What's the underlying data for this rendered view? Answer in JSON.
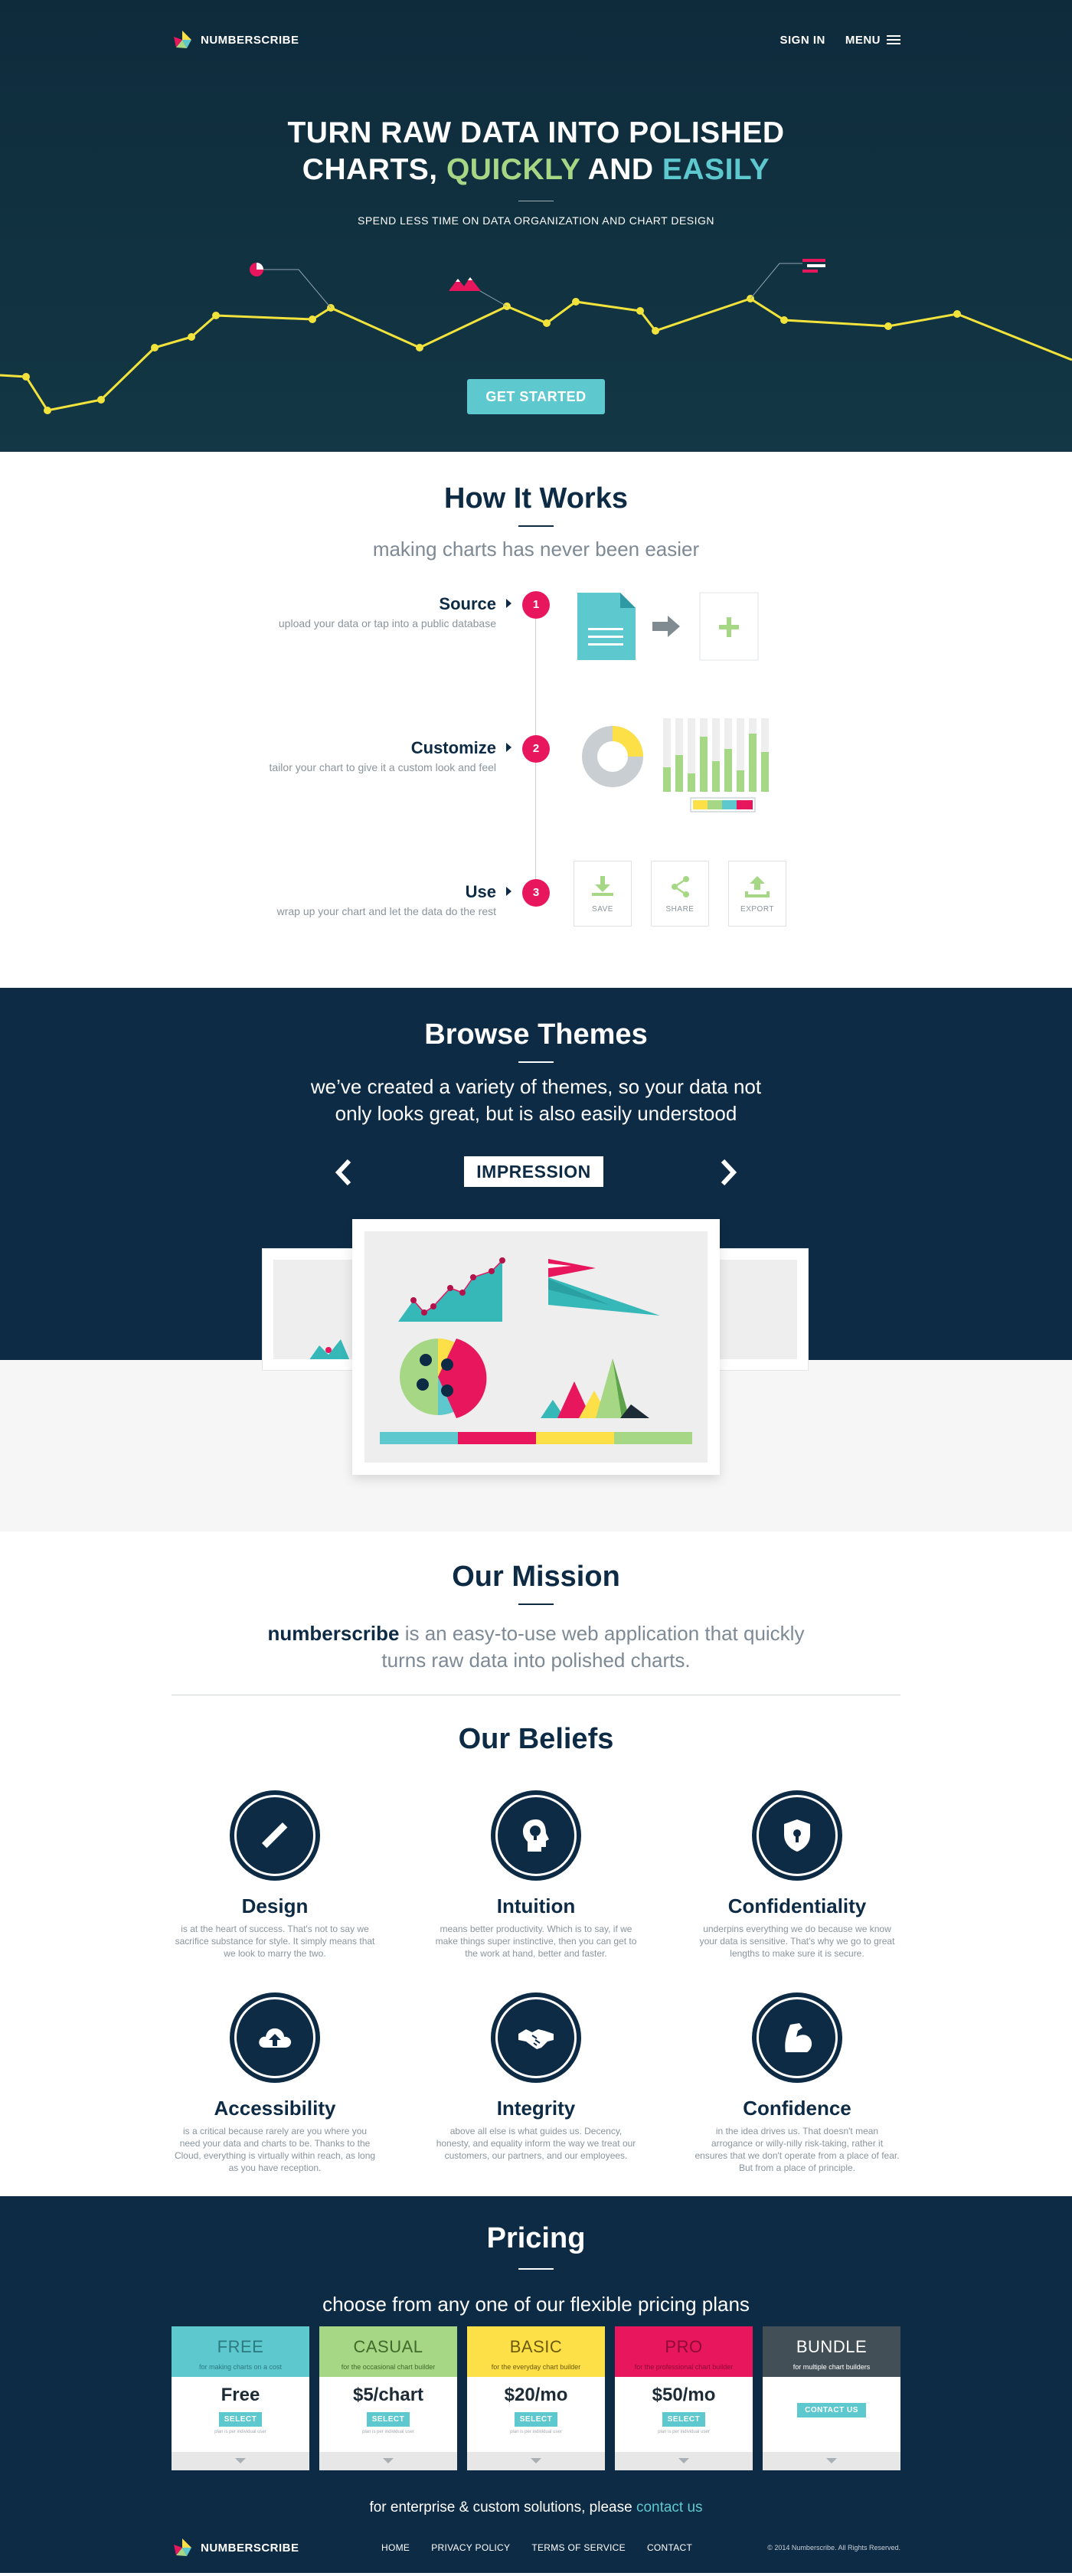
{
  "brand": {
    "name": "NUMBERSCRIBE"
  },
  "nav": {
    "sign_in": "SIGN IN",
    "menu": "MENU"
  },
  "hero": {
    "title_line1": "TURN RAW DATA INTO POLISHED",
    "title_charts": "CHARTS, ",
    "title_quickly": "QUICKLY",
    "title_and": " AND ",
    "title_easily": "EASILY",
    "subtitle": "SPEND LESS TIME ON DATA ORGANIZATION AND CHART DESIGN",
    "cta": "GET STARTED"
  },
  "how": {
    "title": "How It Works",
    "subtitle": "making charts has never been easier",
    "steps": [
      {
        "num": "1",
        "title": "Source",
        "desc": "upload your data or tap into a public database"
      },
      {
        "num": "2",
        "title": "Customize",
        "desc": "tailor your chart to give it a custom look and feel"
      },
      {
        "num": "3",
        "title": "Use",
        "desc": "wrap up your chart and let the data do the rest"
      }
    ],
    "actions": [
      "SAVE",
      "SHARE",
      "EXPORT"
    ]
  },
  "themes": {
    "title": "Browse Themes",
    "subtitle_line1": "we’ve created a variety of themes, so your data not",
    "subtitle_line2": "only looks great, but is also easily understood",
    "current": "IMPRESSION"
  },
  "mission": {
    "title": "Our Mission",
    "brand": "numberscribe",
    "text_line1": " is an easy-to-use web application that quickly",
    "text_line2": "turns raw data into polished charts."
  },
  "beliefs": {
    "title": "Our Beliefs",
    "items": [
      {
        "title": "Design",
        "text": "is at the heart of success. That's not to say we sacrifice substance for style. It simply means that we look to marry the two.",
        "icon": "ruler-pencil-icon"
      },
      {
        "title": "Intuition",
        "text": "means better productivity. Which is to say, if we make things super instinctive, then you can get to the work at hand, better and faster.",
        "icon": "head-bulb-icon"
      },
      {
        "title": "Confidentiality",
        "text": "underpins everything we do because we know your data is sensitive. That's why we go to great lengths to make sure it is secure.",
        "icon": "shield-lock-icon"
      },
      {
        "title": "Accessibility",
        "text": "is a critical because rarely are you where you need your data and charts to be. Thanks to the Cloud, everything is virtually within reach, as long as you have reception.",
        "icon": "cloud-upload-icon"
      },
      {
        "title": "Integrity",
        "text": "above all else is what guides us. Decency, honesty, and equality inform the way we treat our customers, our partners, and our employees.",
        "icon": "handshake-icon"
      },
      {
        "title": "Confidence",
        "text": "in the idea drives us. That doesn't mean arrogance or willy-nilly risk-taking, rather it ensures that we don't operate from a place of fear. But from a place of principle.",
        "icon": "flexed-arm-icon"
      }
    ]
  },
  "pricing": {
    "title": "Pricing",
    "subtitle": "choose from any one of our flexible pricing plans",
    "plans": [
      {
        "name": "FREE",
        "tag": "for making charts on a cost",
        "price": "Free",
        "button": "SELECT",
        "fine": "plan is per individual user",
        "color": "#5ec8cf",
        "name_color": "#2c7a80"
      },
      {
        "name": "CASUAL",
        "tag": "for the occasional chart builder",
        "price": "$5/chart",
        "button": "SELECT",
        "fine": "plan is per individual user",
        "color": "#a6d785",
        "name_color": "#3f6a2a"
      },
      {
        "name": "BASIC",
        "tag": "for the everyday chart builder",
        "price": "$20/mo",
        "button": "SELECT",
        "fine": "plan is per individual user",
        "color": "#fde047",
        "name_color": "#6b5a0c"
      },
      {
        "name": "PRO",
        "tag": "for the professional chart builder",
        "price": "$50/mo",
        "button": "SELECT",
        "fine": "plan is per individual user",
        "color": "#e8175d",
        "name_color": "#8e0a35"
      },
      {
        "name": "BUNDLE",
        "tag": "for multiple chart builders",
        "price": "",
        "button": "CONTACT US",
        "fine": "",
        "color": "#424f56",
        "name_color": "#ffffff"
      }
    ],
    "enterprise_text": "for enterprise & custom solutions, please ",
    "enterprise_link": "contact us"
  },
  "footer": {
    "links": [
      "HOME",
      "PRIVACY POLICY",
      "TERMS OF SERVICE",
      "CONTACT"
    ],
    "copyright": "© 2014 Numberscribe. All Rights Reserved."
  },
  "colors": {
    "navy": "#0e2b45",
    "teal": "#5ec8cf",
    "green": "#a6d785",
    "yellow": "#fde047",
    "pink": "#e8175d"
  }
}
